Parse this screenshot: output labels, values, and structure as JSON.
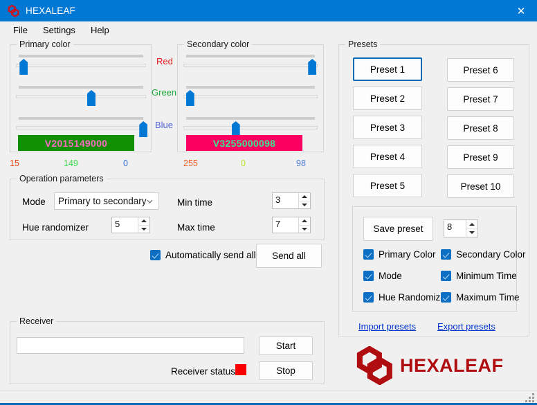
{
  "window": {
    "title": "HEXALEAF",
    "logo_icon": "hexaleaf-logo-icon",
    "close_icon": "close-icon"
  },
  "menubar": {
    "items": [
      {
        "label": "File"
      },
      {
        "label": "Settings"
      },
      {
        "label": "Help"
      }
    ]
  },
  "channel_labels": {
    "red": "Red",
    "green": "Green",
    "blue": "Blue"
  },
  "primary_color": {
    "legend": "Primary color",
    "swatch_text": "V2015149000",
    "swatch_bg": "#108f00",
    "swatch_fg": "#f86bc0",
    "red": {
      "value": "15",
      "percent": 6,
      "color": "#e8430f"
    },
    "green": {
      "value": "149",
      "percent": 58,
      "color": "#3ddb4a"
    },
    "blue": {
      "value": "0",
      "percent": 98,
      "color": "#2f6fe0"
    }
  },
  "secondary_color": {
    "legend": "Secondary color",
    "swatch_text": "V3255000098",
    "swatch_bg": "#fb0060",
    "swatch_fg": "#3be58f",
    "red": {
      "value": "255",
      "percent": 96,
      "color": "#f05a1e"
    },
    "green": {
      "value": "0",
      "percent": 5,
      "color": "#b9e22a"
    },
    "blue": {
      "value": "98",
      "percent": 39,
      "color": "#4b7ad8"
    }
  },
  "operation": {
    "legend": "Operation parameters",
    "mode_label": "Mode",
    "mode_value": "Primary to secondary",
    "mode_chevron_icon": "chevron-down-icon",
    "hue_label": "Hue randomizer",
    "hue_value": "5",
    "min_time_label": "Min time",
    "min_time_value": "3",
    "max_time_label": "Max time",
    "max_time_value": "7",
    "auto_send_label": "Automatically send all",
    "send_all_label": "Send all"
  },
  "presets": {
    "legend": "Presets",
    "buttons_left": [
      {
        "label": "Preset 1",
        "focused": true
      },
      {
        "label": "Preset 2",
        "focused": false
      },
      {
        "label": "Preset 3",
        "focused": false
      },
      {
        "label": "Preset 4",
        "focused": false
      },
      {
        "label": "Preset 5",
        "focused": false
      }
    ],
    "buttons_right": [
      {
        "label": "Preset 6"
      },
      {
        "label": "Preset 7"
      },
      {
        "label": "Preset 8"
      },
      {
        "label": "Preset 9"
      },
      {
        "label": "Preset 10"
      }
    ],
    "save_label": "Save preset",
    "save_slot_value": "8",
    "checkboxes": [
      {
        "label": "Primary Color"
      },
      {
        "label": "Secondary Color"
      },
      {
        "label": "Mode"
      },
      {
        "label": "Minimum Time"
      },
      {
        "label": "Hue Randomizer"
      },
      {
        "label": "Maximum Time"
      }
    ],
    "import_link": "Import presets",
    "export_link": "Export presets"
  },
  "receiver": {
    "legend": "Receiver",
    "input_value": "",
    "input_placeholder": "",
    "start_label": "Start",
    "stop_label": "Stop",
    "status_label": "Receiver status",
    "status_color": "#fb0000"
  },
  "brand": {
    "name": "HEXALEAF",
    "logo_icon": "hexaleaf-logo-icon",
    "color": "#b00d11"
  }
}
